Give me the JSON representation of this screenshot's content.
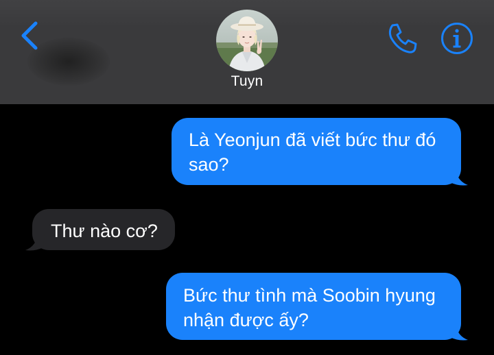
{
  "header": {
    "contact_name": "Tuyn",
    "back_icon": "chevron-left-icon",
    "call_icon": "phone-icon",
    "info_icon": "info-icon",
    "accent_color": "#1a82fb"
  },
  "messages": [
    {
      "direction": "sent",
      "text": "Là Yeonjun đã viết bức thư đó sao?",
      "line1": "Là Yeonjun đã viết bức thư đó",
      "line2": "sao?"
    },
    {
      "direction": "received",
      "text": "Thư nào cơ?"
    },
    {
      "direction": "sent",
      "text": "Bức thư tình mà Soobin hyung nhận được ấy?",
      "line1": "Bức thư tình mà Soobin hyung",
      "line2": "nhận được ấy?"
    }
  ],
  "colors": {
    "sent_bubble": "#1a82fb",
    "received_bubble": "#262629",
    "background": "#000000",
    "header": "#3a3a3c"
  }
}
